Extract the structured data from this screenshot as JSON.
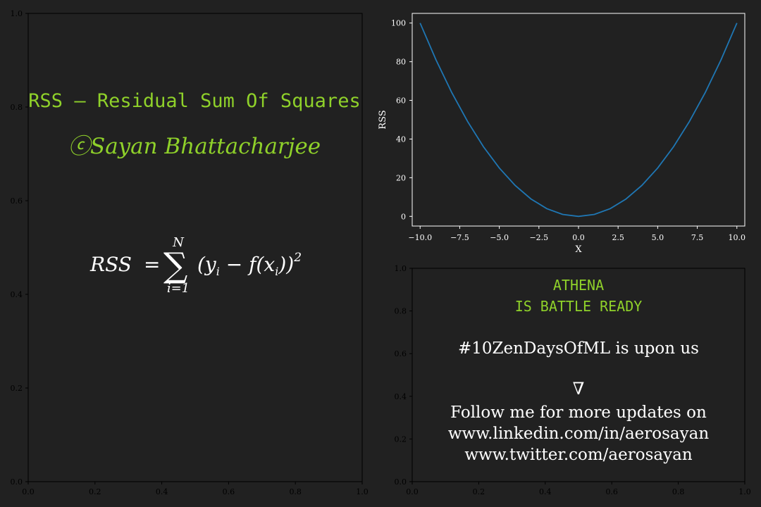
{
  "colors": {
    "background": "#212121",
    "accent_green": "#8fd12a",
    "line_blue": "#1f77b4",
    "text": "#ffffff",
    "spine": "#000000"
  },
  "left_panel": {
    "title": "RSS — Residual Sum Of Squares",
    "author": "ⓒSayan Bhattacharjee",
    "formula_lhs": "RSS",
    "formula_eq": "=",
    "formula_sigma": "∑",
    "formula_upper": "N",
    "formula_lower": "i=1",
    "formula_body": "(y",
    "formula_sub_i": "i",
    "formula_mid": " − f(x",
    "formula_sub_i2": "i",
    "formula_end": "))",
    "formula_power": "2",
    "xticks": [
      "0.0",
      "0.2",
      "0.4",
      "0.6",
      "0.8",
      "1.0"
    ],
    "yticks": [
      "0.0",
      "0.2",
      "0.4",
      "0.6",
      "0.8",
      "1.0"
    ]
  },
  "bottom_right_panel": {
    "line1": "ATHENA",
    "line2": "IS BATTLE READY",
    "line3": "#10ZenDaysOfML is upon us",
    "symbol": "∇",
    "line4": "Follow me for more updates on",
    "line5": "www.linkedin.com/in/aerosayan",
    "line6": "www.twitter.com/aerosayan",
    "xticks": [
      "0.0",
      "0.2",
      "0.4",
      "0.6",
      "0.8",
      "1.0"
    ],
    "yticks": [
      "0.0",
      "0.2",
      "0.4",
      "0.6",
      "0.8",
      "1.0"
    ]
  },
  "chart_data": {
    "type": "line",
    "xlabel": "X",
    "ylabel": "RSS",
    "xlim": [
      -10.5,
      10.5
    ],
    "ylim": [
      -5,
      105
    ],
    "xticks": [
      "−10.0",
      "−7.5",
      "−5.0",
      "−2.5",
      "0.0",
      "2.5",
      "5.0",
      "7.5",
      "10.0"
    ],
    "xtick_values": [
      -10,
      -7.5,
      -5,
      -2.5,
      0,
      2.5,
      5,
      7.5,
      10
    ],
    "yticks": [
      "0",
      "20",
      "40",
      "60",
      "80",
      "100"
    ],
    "ytick_values": [
      0,
      20,
      40,
      60,
      80,
      100
    ],
    "grid": false,
    "series": [
      {
        "color": "#1f77b4",
        "x": [
          -10,
          -9,
          -8,
          -7,
          -6,
          -5,
          -4,
          -3,
          -2,
          -1,
          0,
          1,
          2,
          3,
          4,
          5,
          6,
          7,
          8,
          9,
          10
        ],
        "y": [
          100,
          81,
          64,
          49,
          36,
          25,
          16,
          9,
          4,
          1,
          0,
          1,
          4,
          9,
          16,
          25,
          36,
          49,
          64,
          81,
          100
        ]
      }
    ]
  }
}
